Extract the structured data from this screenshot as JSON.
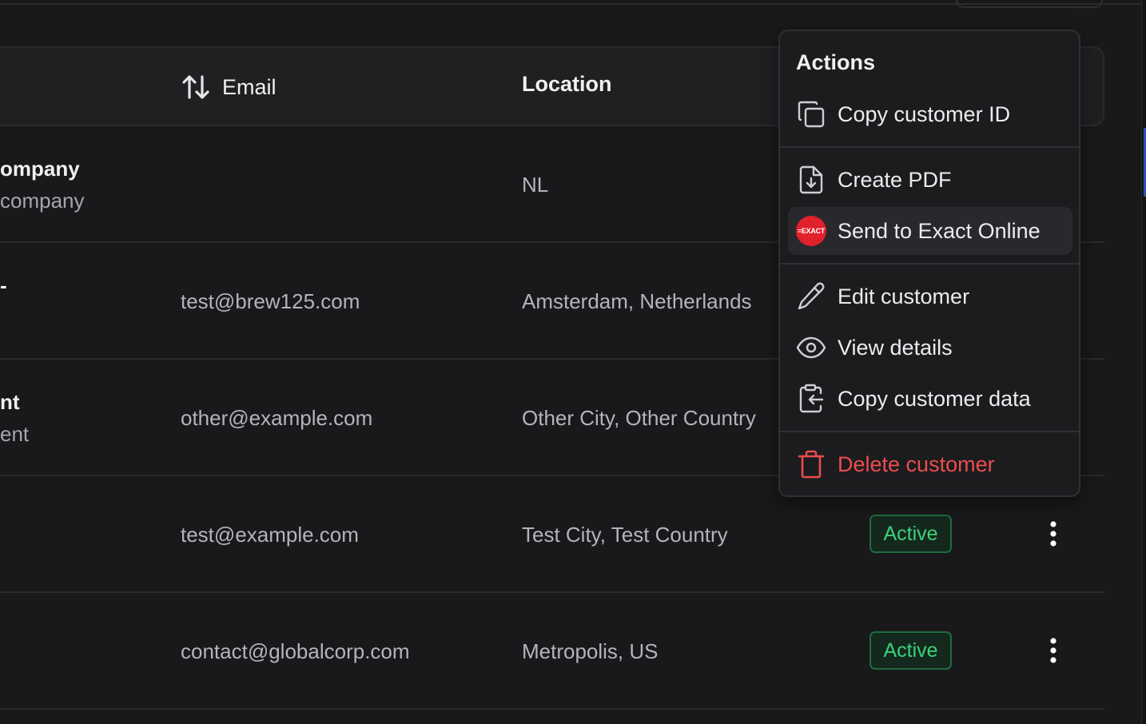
{
  "table": {
    "columns": {
      "email": "Email",
      "location": "Location"
    },
    "rows": [
      {
        "name": "ompany",
        "name_sub": "company",
        "email": "",
        "location": "NL",
        "status": ""
      },
      {
        "name": "-",
        "name_sub": "",
        "email": "test@brew125.com",
        "location": "Amsterdam, Netherlands",
        "status": ""
      },
      {
        "name": "nt",
        "name_sub": "ent",
        "email": "other@example.com",
        "location": "Other City, Other Country",
        "status": ""
      },
      {
        "name": "",
        "name_sub": "",
        "email": "test@example.com",
        "location": "Test City, Test Country",
        "status": "Active"
      },
      {
        "name": "",
        "name_sub": "",
        "email": "contact@globalcorp.com",
        "location": "Metropolis, US",
        "status": "Active"
      }
    ]
  },
  "menu": {
    "title": "Actions",
    "items": [
      {
        "label": "Copy customer ID",
        "icon": "copy-icon"
      },
      {
        "label": "Create PDF",
        "icon": "file-download-icon"
      },
      {
        "label": "Send to Exact Online",
        "icon": "exact-online-logo",
        "logo_text": "=EXACT"
      },
      {
        "label": "Edit customer",
        "icon": "pencil-icon"
      },
      {
        "label": "View details",
        "icon": "eye-icon"
      },
      {
        "label": "Copy customer data",
        "icon": "clipboard-copy-icon"
      },
      {
        "label": "Delete customer",
        "icon": "trash-icon"
      }
    ]
  },
  "colors": {
    "background": "#19191b",
    "active_badge": "#3ad27a",
    "danger": "#ea4d4d",
    "exact_brand": "#e0202a"
  }
}
